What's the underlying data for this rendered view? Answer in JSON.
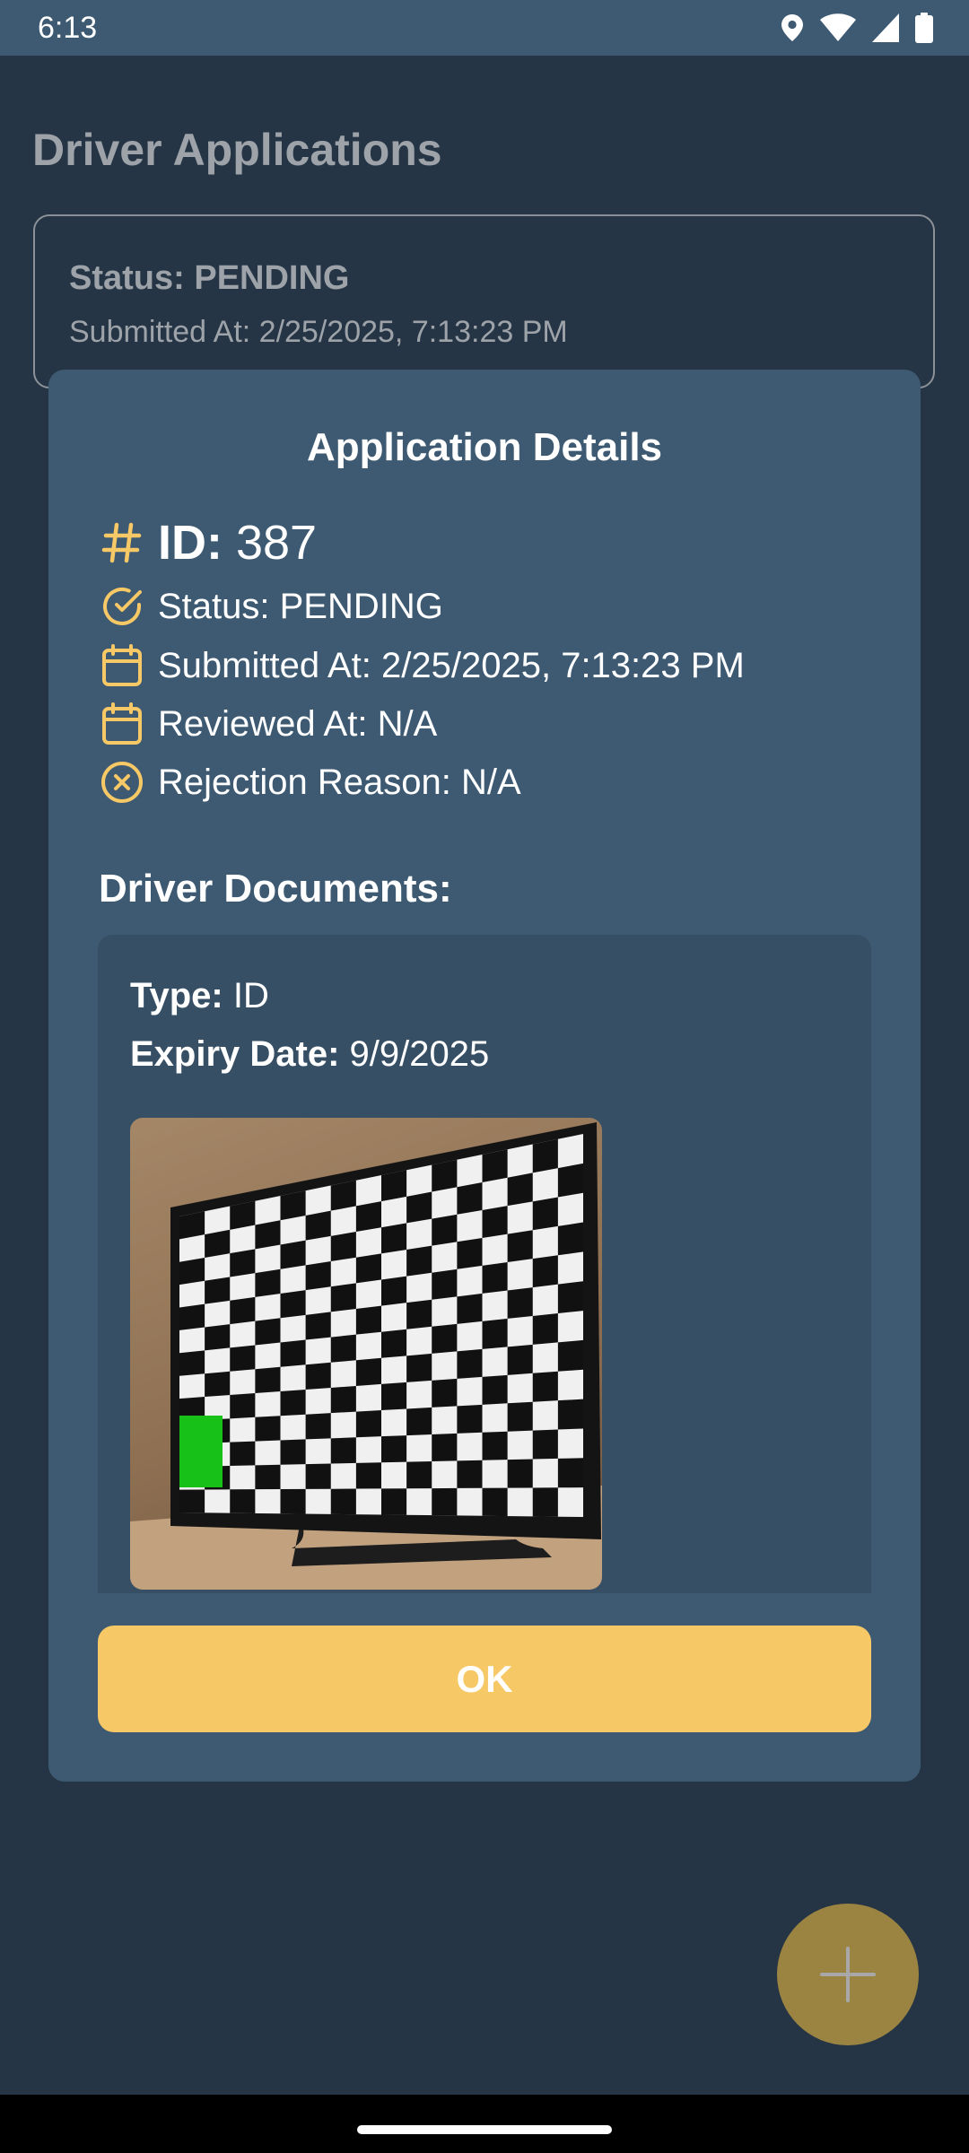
{
  "status_bar": {
    "time": "6:13",
    "icons": [
      "location-icon",
      "wifi-icon",
      "cellular-signal-icon",
      "battery-icon"
    ]
  },
  "page": {
    "title": "Driver Applications"
  },
  "application_card": {
    "status": "Status: PENDING",
    "submitted": "Submitted At: 2/25/2025, 7:13:23 PM"
  },
  "dialog": {
    "title": "Application Details",
    "id_label": "ID:",
    "id_value": " 387",
    "status": "Status: PENDING",
    "submitted": "Submitted At: 2/25/2025, 7:13:23 PM",
    "reviewed": "Reviewed At: N/A",
    "rejection": "Rejection Reason: N/A",
    "documents_heading": "Driver Documents:",
    "documents": [
      {
        "type_label": "Type:",
        "type_value": " ID",
        "expiry_label": "Expiry Date:",
        "expiry_value": " 9/9/2025"
      }
    ],
    "ok_label": "OK"
  },
  "colors": {
    "accent": "#f6c866",
    "dialog_bg": "#3e5a72",
    "page_bg": "#253545",
    "fab": "#9b8442"
  }
}
